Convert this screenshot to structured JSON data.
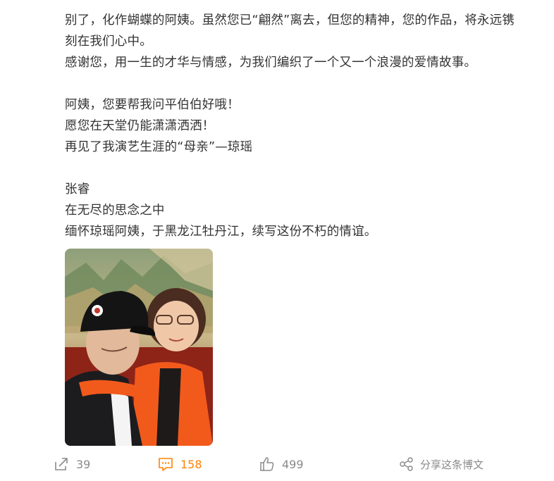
{
  "post": {
    "paragraph1": [
      "别了，化作蝴蝶的阿姨。虽然您已“翩然”离去，但您的精神，您的作品，将永远镌",
      "刻在我们心中。",
      "感谢您，用一生的才华与情感，为我们编织了一个又一个浪漫的爱情故事。"
    ],
    "paragraph2": [
      "阿姨，您要帮我问平伯伯好哦！",
      "愿您在天堂仍能潇潇洒洒！",
      "再见了我演艺生涯的“母亲”—琼瑶"
    ],
    "paragraph3": [
      "张睿",
      "在无尽的思念之中",
      "缅怀琼瑶阿姨，于黑龙江牡丹江，续写这份不朽的情谊。"
    ]
  },
  "actions": {
    "repost_count": "39",
    "comment_count": "158",
    "like_count": "499",
    "share_label": "分享这条博文"
  },
  "icons": {
    "repost": "repost-icon",
    "comment": "comment-icon",
    "like": "thumbs-up-icon",
    "share": "share-icon"
  },
  "colors": {
    "text": "#333333",
    "muted": "#8a8a8a",
    "accent": "#ff8200"
  }
}
